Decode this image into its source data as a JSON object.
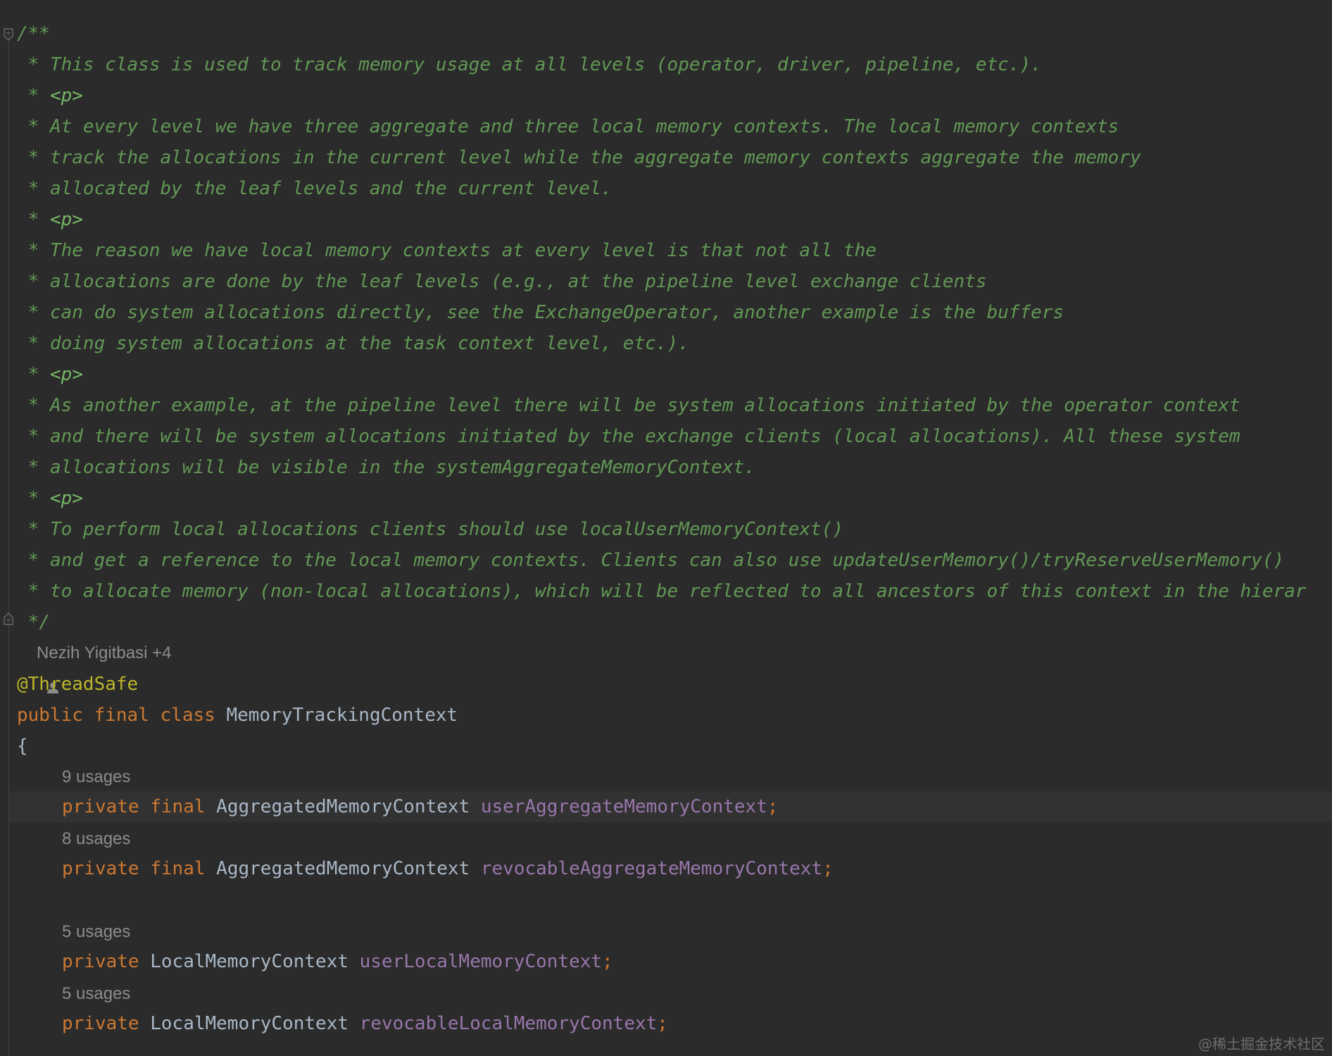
{
  "editor": {
    "doc_comment": [
      "/**",
      " * This class is used to track memory usage at all levels (operator, driver, pipeline, etc.).",
      " * <p>",
      " * At every level we have three aggregate and three local memory contexts. The local memory contexts",
      " * track the allocations in the current level while the aggregate memory contexts aggregate the memory",
      " * allocated by the leaf levels and the current level.",
      " * <p>",
      " * The reason we have local memory contexts at every level is that not all the",
      " * allocations are done by the leaf levels (e.g., at the pipeline level exchange clients",
      " * can do system allocations directly, see the ExchangeOperator, another example is the buffers",
      " * doing system allocations at the task context level, etc.).",
      " * <p>",
      " * As another example, at the pipeline level there will be system allocations initiated by the operator context",
      " * and there will be system allocations initiated by the exchange clients (local allocations). All these system",
      " * allocations will be visible in the systemAggregateMemoryContext.",
      " * <p>",
      " * To perform local allocations clients should use localUserMemoryContext()",
      " * and get a reference to the local memory contexts. Clients can also use updateUserMemory()/tryReserveUserMemory()",
      " * to allocate memory (non-local allocations), which will be reflected to all ancestors of this context in the hierar",
      " */"
    ],
    "author_hint": "Nezih Yigitbasi +4",
    "annotation": "@ThreadSafe",
    "class_decl": {
      "kw_public": "public",
      "kw_final": "final",
      "kw_class": "class",
      "name": "MemoryTrackingContext"
    },
    "open_brace": "{",
    "fields": [
      {
        "usages": "9 usages",
        "kw_private": "private",
        "kw_final": "final",
        "type": "AggregatedMemoryContext",
        "name": "userAggregateMemoryContext",
        "semicolon": ";"
      },
      {
        "usages": "8 usages",
        "kw_private": "private",
        "kw_final": "final",
        "type": "AggregatedMemoryContext",
        "name": "revocableAggregateMemoryContext",
        "semicolon": ";"
      },
      {
        "usages": "5 usages",
        "kw_private": "private",
        "kw_final": "",
        "type": "LocalMemoryContext",
        "name": "userLocalMemoryContext",
        "semicolon": ";"
      },
      {
        "usages": "5 usages",
        "kw_private": "private",
        "kw_final": "",
        "type": "LocalMemoryContext",
        "name": "revocableLocalMemoryContext",
        "semicolon": ";"
      }
    ],
    "colors": {
      "background": "#2b2b2b",
      "doc_comment": "#629755",
      "keyword": "#cc7832",
      "annotation": "#bbb529",
      "field": "#9876aa",
      "identifier": "#a9b7c6",
      "hint": "#8c8c8c"
    },
    "icons": [
      "fold-icon",
      "person-icon"
    ]
  },
  "watermark": "@稀土掘金技术社区"
}
